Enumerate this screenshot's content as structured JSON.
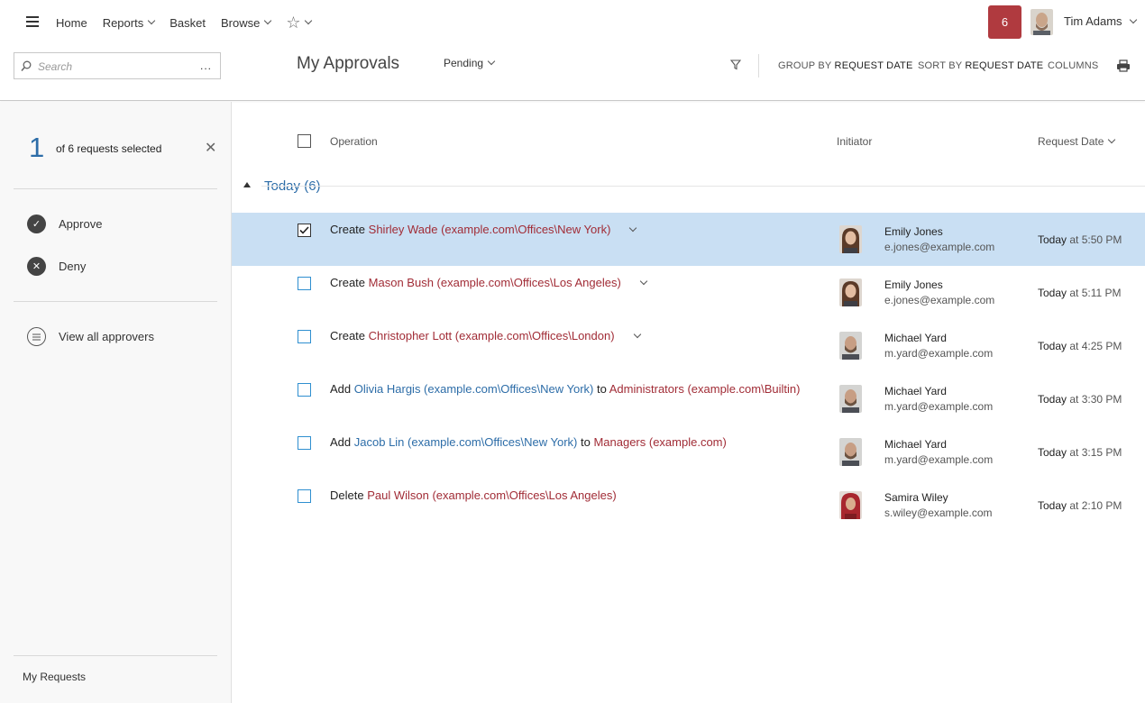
{
  "nav": {
    "items": [
      {
        "label": "Home",
        "dropdown": false
      },
      {
        "label": "Reports",
        "dropdown": true
      },
      {
        "label": "Basket",
        "dropdown": false
      },
      {
        "label": "Browse",
        "dropdown": true
      }
    ],
    "favorites_icon": "star-icon"
  },
  "notifications": {
    "count": "6",
    "color": "#b03a3f"
  },
  "user": {
    "name": "Tim Adams"
  },
  "search": {
    "placeholder": "Search",
    "more": "..."
  },
  "page": {
    "title": "My Approvals",
    "status_filter": "Pending"
  },
  "toolbar": {
    "group_by_label": "GROUP BY",
    "group_by_value": "REQUEST DATE",
    "sort_by_label": "SORT BY",
    "sort_by_value": "REQUEST DATE",
    "columns_label": "COLUMNS"
  },
  "sidebar": {
    "selected_count": "1",
    "selected_text": "of 6 requests selected",
    "approve_label": "Approve",
    "deny_label": "Deny",
    "view_approvers_label": "View all approvers",
    "my_requests_label": "My Requests"
  },
  "table": {
    "columns": {
      "operation": "Operation",
      "initiator": "Initiator",
      "request_date": "Request Date"
    },
    "group": {
      "label": "Today (6)"
    },
    "rows": [
      {
        "selected": true,
        "verb": "Create",
        "target": "Shirley Wade (example.com\\Offices\\New York)",
        "connector": "",
        "group_target": "",
        "expandable": true,
        "initiator_name": "Emily Jones",
        "initiator_email": "e.jones@example.com",
        "date_day": "Today",
        "date_time": "at 5:50 PM"
      },
      {
        "selected": false,
        "verb": "Create",
        "target": "Mason Bush (example.com\\Offices\\Los Angeles)",
        "connector": "",
        "group_target": "",
        "expandable": true,
        "initiator_name": "Emily Jones",
        "initiator_email": "e.jones@example.com",
        "date_day": "Today",
        "date_time": "at 5:11 PM"
      },
      {
        "selected": false,
        "verb": "Create",
        "target": "Christopher Lott (example.com\\Offices\\London)",
        "connector": "",
        "group_target": "",
        "expandable": true,
        "initiator_name": "Michael Yard",
        "initiator_email": "m.yard@example.com",
        "date_day": "Today",
        "date_time": "at 4:25 PM"
      },
      {
        "selected": false,
        "verb": "Add",
        "target": "Olivia Hargis (example.com\\Offices\\New York)",
        "connector": "to",
        "group_target": "Administrators (example.com\\Builtin)",
        "expandable": false,
        "initiator_name": "Michael Yard",
        "initiator_email": "m.yard@example.com",
        "date_day": "Today",
        "date_time": "at 3:30 PM"
      },
      {
        "selected": false,
        "verb": "Add",
        "target": "Jacob Lin (example.com\\Offices\\New York)",
        "connector": "to",
        "group_target": "Managers (example.com)",
        "expandable": false,
        "initiator_name": "Michael Yard",
        "initiator_email": "m.yard@example.com",
        "date_day": "Today",
        "date_time": "at 3:15 PM"
      },
      {
        "selected": false,
        "verb": "Delete",
        "target": "Paul Wilson (example.com\\Offices\\Los Angeles)",
        "connector": "",
        "group_target": "",
        "expandable": false,
        "initiator_name": "Samira Wiley",
        "initiator_email": "s.wiley@example.com",
        "date_day": "Today",
        "date_time": "at 2:10 PM"
      }
    ]
  },
  "colors": {
    "accent_blue": "#2d6da8",
    "object_red": "#a12c36",
    "selected_row": "#c9dff3"
  }
}
